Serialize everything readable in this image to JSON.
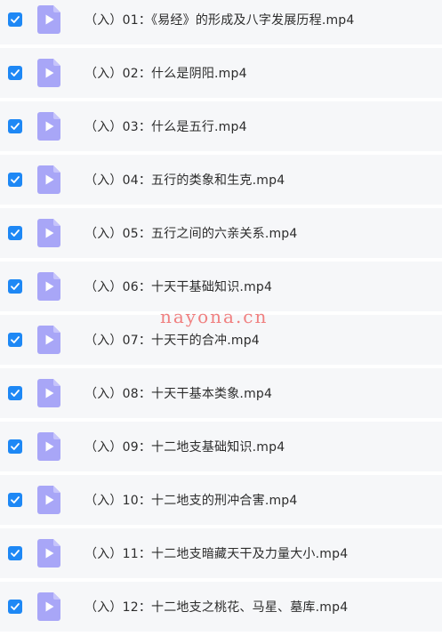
{
  "files": [
    {
      "name": "（入）01：《易经》的形成及八字发展历程.mp4",
      "checked": true
    },
    {
      "name": "（入）02：什么是阴阳.mp4",
      "checked": true
    },
    {
      "name": "（入）03：什么是五行.mp4",
      "checked": true
    },
    {
      "name": "（入）04：五行的类象和生克.mp4",
      "checked": true
    },
    {
      "name": "（入）05：五行之间的六亲关系.mp4",
      "checked": true
    },
    {
      "name": "（入）06：十天干基础知识.mp4",
      "checked": true
    },
    {
      "name": "（入）07：十天干的合冲.mp4",
      "checked": true
    },
    {
      "name": "（入）08：十天干基本类象.mp4",
      "checked": true
    },
    {
      "name": "（入）09：十二地支基础知识.mp4",
      "checked": true
    },
    {
      "name": "（入）10：十二地支的刑冲合害.mp4",
      "checked": true
    },
    {
      "name": "（入）11：十二地支暗藏天干及力量大小.mp4",
      "checked": true
    },
    {
      "name": "（入）12：十二地支之桃花、马星、墓库.mp4",
      "checked": true
    }
  ],
  "watermark": "nayona.cn",
  "colors": {
    "checkbox": "#1e88f5",
    "file_icon": "#a8a6f7",
    "row_background": "#f6f7f9",
    "watermark": "#f08080"
  },
  "icons": {
    "checkbox": "check-icon",
    "file": "video-file-icon"
  }
}
